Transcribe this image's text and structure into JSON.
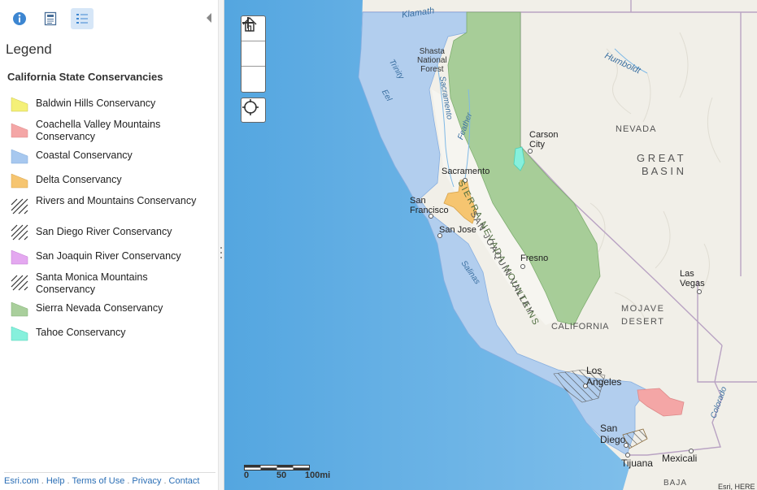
{
  "sidebar": {
    "tabs": [
      {
        "name": "about",
        "icon": "info-icon"
      },
      {
        "name": "content",
        "icon": "content-icon"
      },
      {
        "name": "legend",
        "icon": "legend-icon"
      }
    ],
    "legend_heading": "Legend",
    "layer_title": "California State Conservancies",
    "legend_items": [
      {
        "label": "Baldwin Hills Conservancy",
        "color": "#f4f078"
      },
      {
        "label": "Coachella Valley Mountains Conservancy",
        "color": "#f4a6a6"
      },
      {
        "label": "Coastal Conservancy",
        "color": "#a7c8ef"
      },
      {
        "label": "Delta Conservancy",
        "color": "#f6c570"
      },
      {
        "label": "Rivers and Mountains Conservancy",
        "color": "hatch"
      },
      {
        "label": "San Diego River Conservancy",
        "color": "hatch"
      },
      {
        "label": "San Joaquin River Conservancy",
        "color": "#e4a8f0"
      },
      {
        "label": "Santa Monica Mountains Conservancy",
        "color": "hatch"
      },
      {
        "label": "Sierra Nevada Conservancy",
        "color": "#a9cf9c"
      },
      {
        "label": "Tahoe Conservancy",
        "color": "#86f0dc"
      }
    ],
    "footer": {
      "links": [
        "Esri.com",
        "Help",
        "Terms of Use",
        "Privacy",
        "Contact"
      ]
    }
  },
  "map": {
    "controls": {
      "zoom_in": "+",
      "home_icon": "home-icon",
      "zoom_out": "−",
      "locate_icon": "locate-icon"
    },
    "scale": {
      "l0": "0",
      "l1": "50",
      "l2": "100mi"
    },
    "labels": {
      "klamath": "Klamath",
      "shasta": "Shasta\nNational\nForest",
      "humboldt": "Humboldt",
      "trinity": "Trinity",
      "eel": "Eel",
      "sacramento_river": "Sacramento",
      "feather": "Feather",
      "sierra_nevada": "SIERRA  NEVADA  MOUNTAINS",
      "nevada": "NEVADA",
      "great": "G R E A T",
      "basin": "B A S I N",
      "carson_city": "Carson\nCity",
      "sacramento": "Sacramento",
      "san_francisco": "San\nFrancisco",
      "san_jose": "San Jose",
      "san_joaquin": "SAN JOAQUIN VALLEY",
      "salinas": "Salinas",
      "fresno": "Fresno",
      "las_vegas": "Las\nVegas",
      "mojave": "MOJAVE\nDESERT",
      "california": "CALIFORNIA",
      "los_angeles": "Los\nAngeles",
      "colorado": "Colorado",
      "san_diego": "San\nDiego",
      "mexicali": "Mexicali",
      "tijuana": "Tijuana",
      "baja": "BAJA",
      "attribution": "Esri, HERE"
    }
  }
}
